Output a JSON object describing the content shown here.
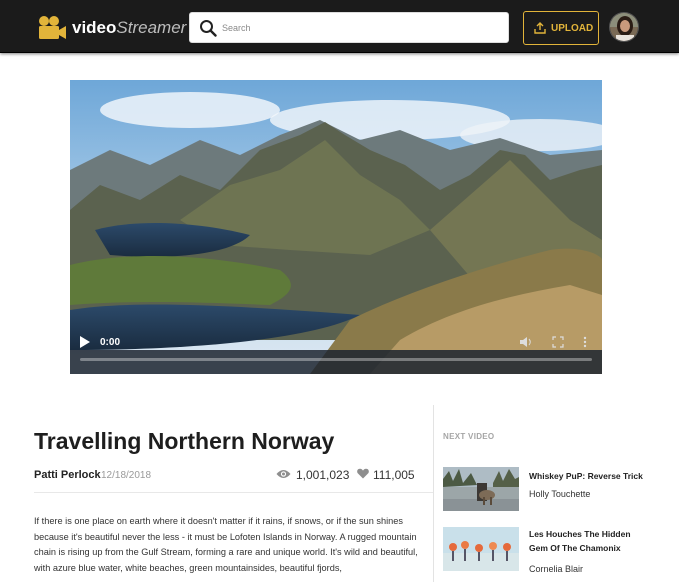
{
  "header": {
    "brand_bold": "video",
    "brand_italic": "Streamer",
    "search_placeholder": "Search",
    "upload_label": "UPLOAD",
    "logo_icon": "film-camera-icon",
    "accent_color": "#e2b43a"
  },
  "player": {
    "time": "0:00",
    "progress": 0
  },
  "video": {
    "title": "Travelling Northern Norway",
    "author": "Patti Perlock",
    "date": "12/18/2018",
    "views": "1,001,023",
    "likes": "111,005",
    "description": "If there is one place on earth where it doesn't matter if it rains, if snows, or if the sun shines because it's beautiful never the less - it must be Lofoten Islands in Norway. A rugged mountain chain is rising up from the Gulf Stream, forming a rare and unique world. It's wild and beautiful, with azure blue water, white beaches, green mountainsides, beautiful fjords,"
  },
  "next": {
    "heading": "NEXT VIDEO",
    "items": [
      {
        "title": "Whiskey PuP: Reverse Trick",
        "author": "Holly Touchette"
      },
      {
        "title": "Les Houches The Hidden Gem Of The Chamonix",
        "author": "Cornelia Blair"
      }
    ]
  }
}
